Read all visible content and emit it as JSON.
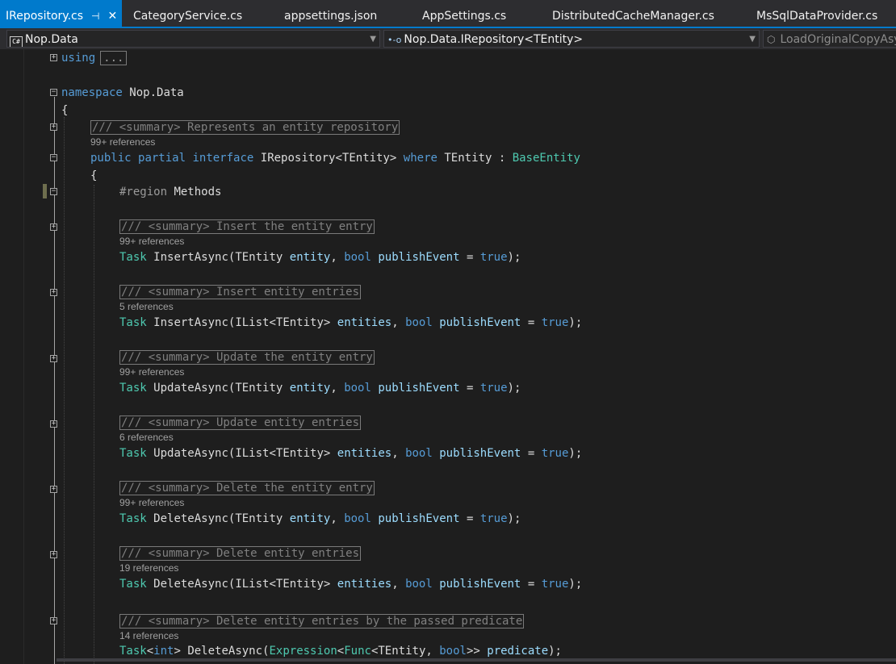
{
  "tabs": [
    {
      "label": "IRepository.cs",
      "active": true
    },
    {
      "label": "CategoryService.cs",
      "active": false
    },
    {
      "label": "appsettings.json",
      "active": false
    },
    {
      "label": "AppSettings.cs",
      "active": false
    },
    {
      "label": "DistributedCacheManager.cs",
      "active": false
    },
    {
      "label": "MsSqlDataProvider.cs",
      "active": false
    }
  ],
  "nav": {
    "project_icon": "C#",
    "project": "Nop.Data",
    "type": "Nop.Data.IRepository<TEntity>",
    "member": "LoadOriginalCopyAsy"
  },
  "code": {
    "using_kw": "using",
    "using_collapsed": "...",
    "namespace_kw": "namespace",
    "namespace_name": "Nop.Data",
    "open_brace": "{",
    "iface_summary": "/// <summary> Represents an entity repository",
    "iface_refs": "99+ references",
    "iface_public": "public",
    "iface_partial": "partial",
    "iface_interface": "interface",
    "iface_name": "IRepository<TEntity>",
    "iface_where": "where",
    "iface_tentity": "TEntity",
    "iface_colon": ":",
    "iface_base": "BaseEntity",
    "iface_brace": "{",
    "region_kw": "#region",
    "region_name": "Methods",
    "methods": [
      {
        "summary": "/// <summary> Insert the entity entry",
        "refs": "99+ references",
        "ret": "Task",
        "name": "InsertAsync",
        "ptype_pre": "TEntity",
        "ptype_gen": "",
        "pname": "entity"
      },
      {
        "summary": "/// <summary> Insert entity entries",
        "refs": "5 references",
        "ret": "Task",
        "name": "InsertAsync",
        "ptype_pre": "IList<TEntity>",
        "ptype_gen": "",
        "pname": "entities"
      },
      {
        "summary": "/// <summary> Update the entity entry",
        "refs": "99+ references",
        "ret": "Task",
        "name": "UpdateAsync",
        "ptype_pre": "TEntity",
        "ptype_gen": "",
        "pname": "entity"
      },
      {
        "summary": "/// <summary> Update entity entries",
        "refs": "6 references",
        "ret": "Task",
        "name": "UpdateAsync",
        "ptype_pre": "IList<TEntity>",
        "ptype_gen": "",
        "pname": "entities"
      },
      {
        "summary": "/// <summary> Delete the entity entry",
        "refs": "99+ references",
        "ret": "Task",
        "name": "DeleteAsync",
        "ptype_pre": "TEntity",
        "ptype_gen": "",
        "pname": "entity"
      },
      {
        "summary": "/// <summary> Delete entity entries",
        "refs": "19 references",
        "ret": "Task",
        "name": "DeleteAsync",
        "ptype_pre": "IList<TEntity>",
        "ptype_gen": "",
        "pname": "entities"
      }
    ],
    "bool_kw": "bool",
    "publish_event": "publishEvent",
    "equals": "=",
    "true_kw": "true",
    "close_paren": ");",
    "last_summary": "/// <summary> Delete entity entries by the passed predicate",
    "last_refs": "14 references",
    "last_task": "Task",
    "last_lt": "<",
    "last_int": "int",
    "last_gt": ">",
    "last_name": "DeleteAsync(",
    "last_expression": "Expression",
    "last_func": "Func",
    "last_tentity": "TEntity,",
    "last_bool": "bool",
    "last_closegen": ">>",
    "last_pname": "predicate",
    "last_end": ");"
  },
  "colors": {
    "accent": "#007acc",
    "keyword": "#569cd6",
    "type": "#4ec9b0",
    "parameter": "#9cdcfe",
    "comment": "#808080"
  }
}
